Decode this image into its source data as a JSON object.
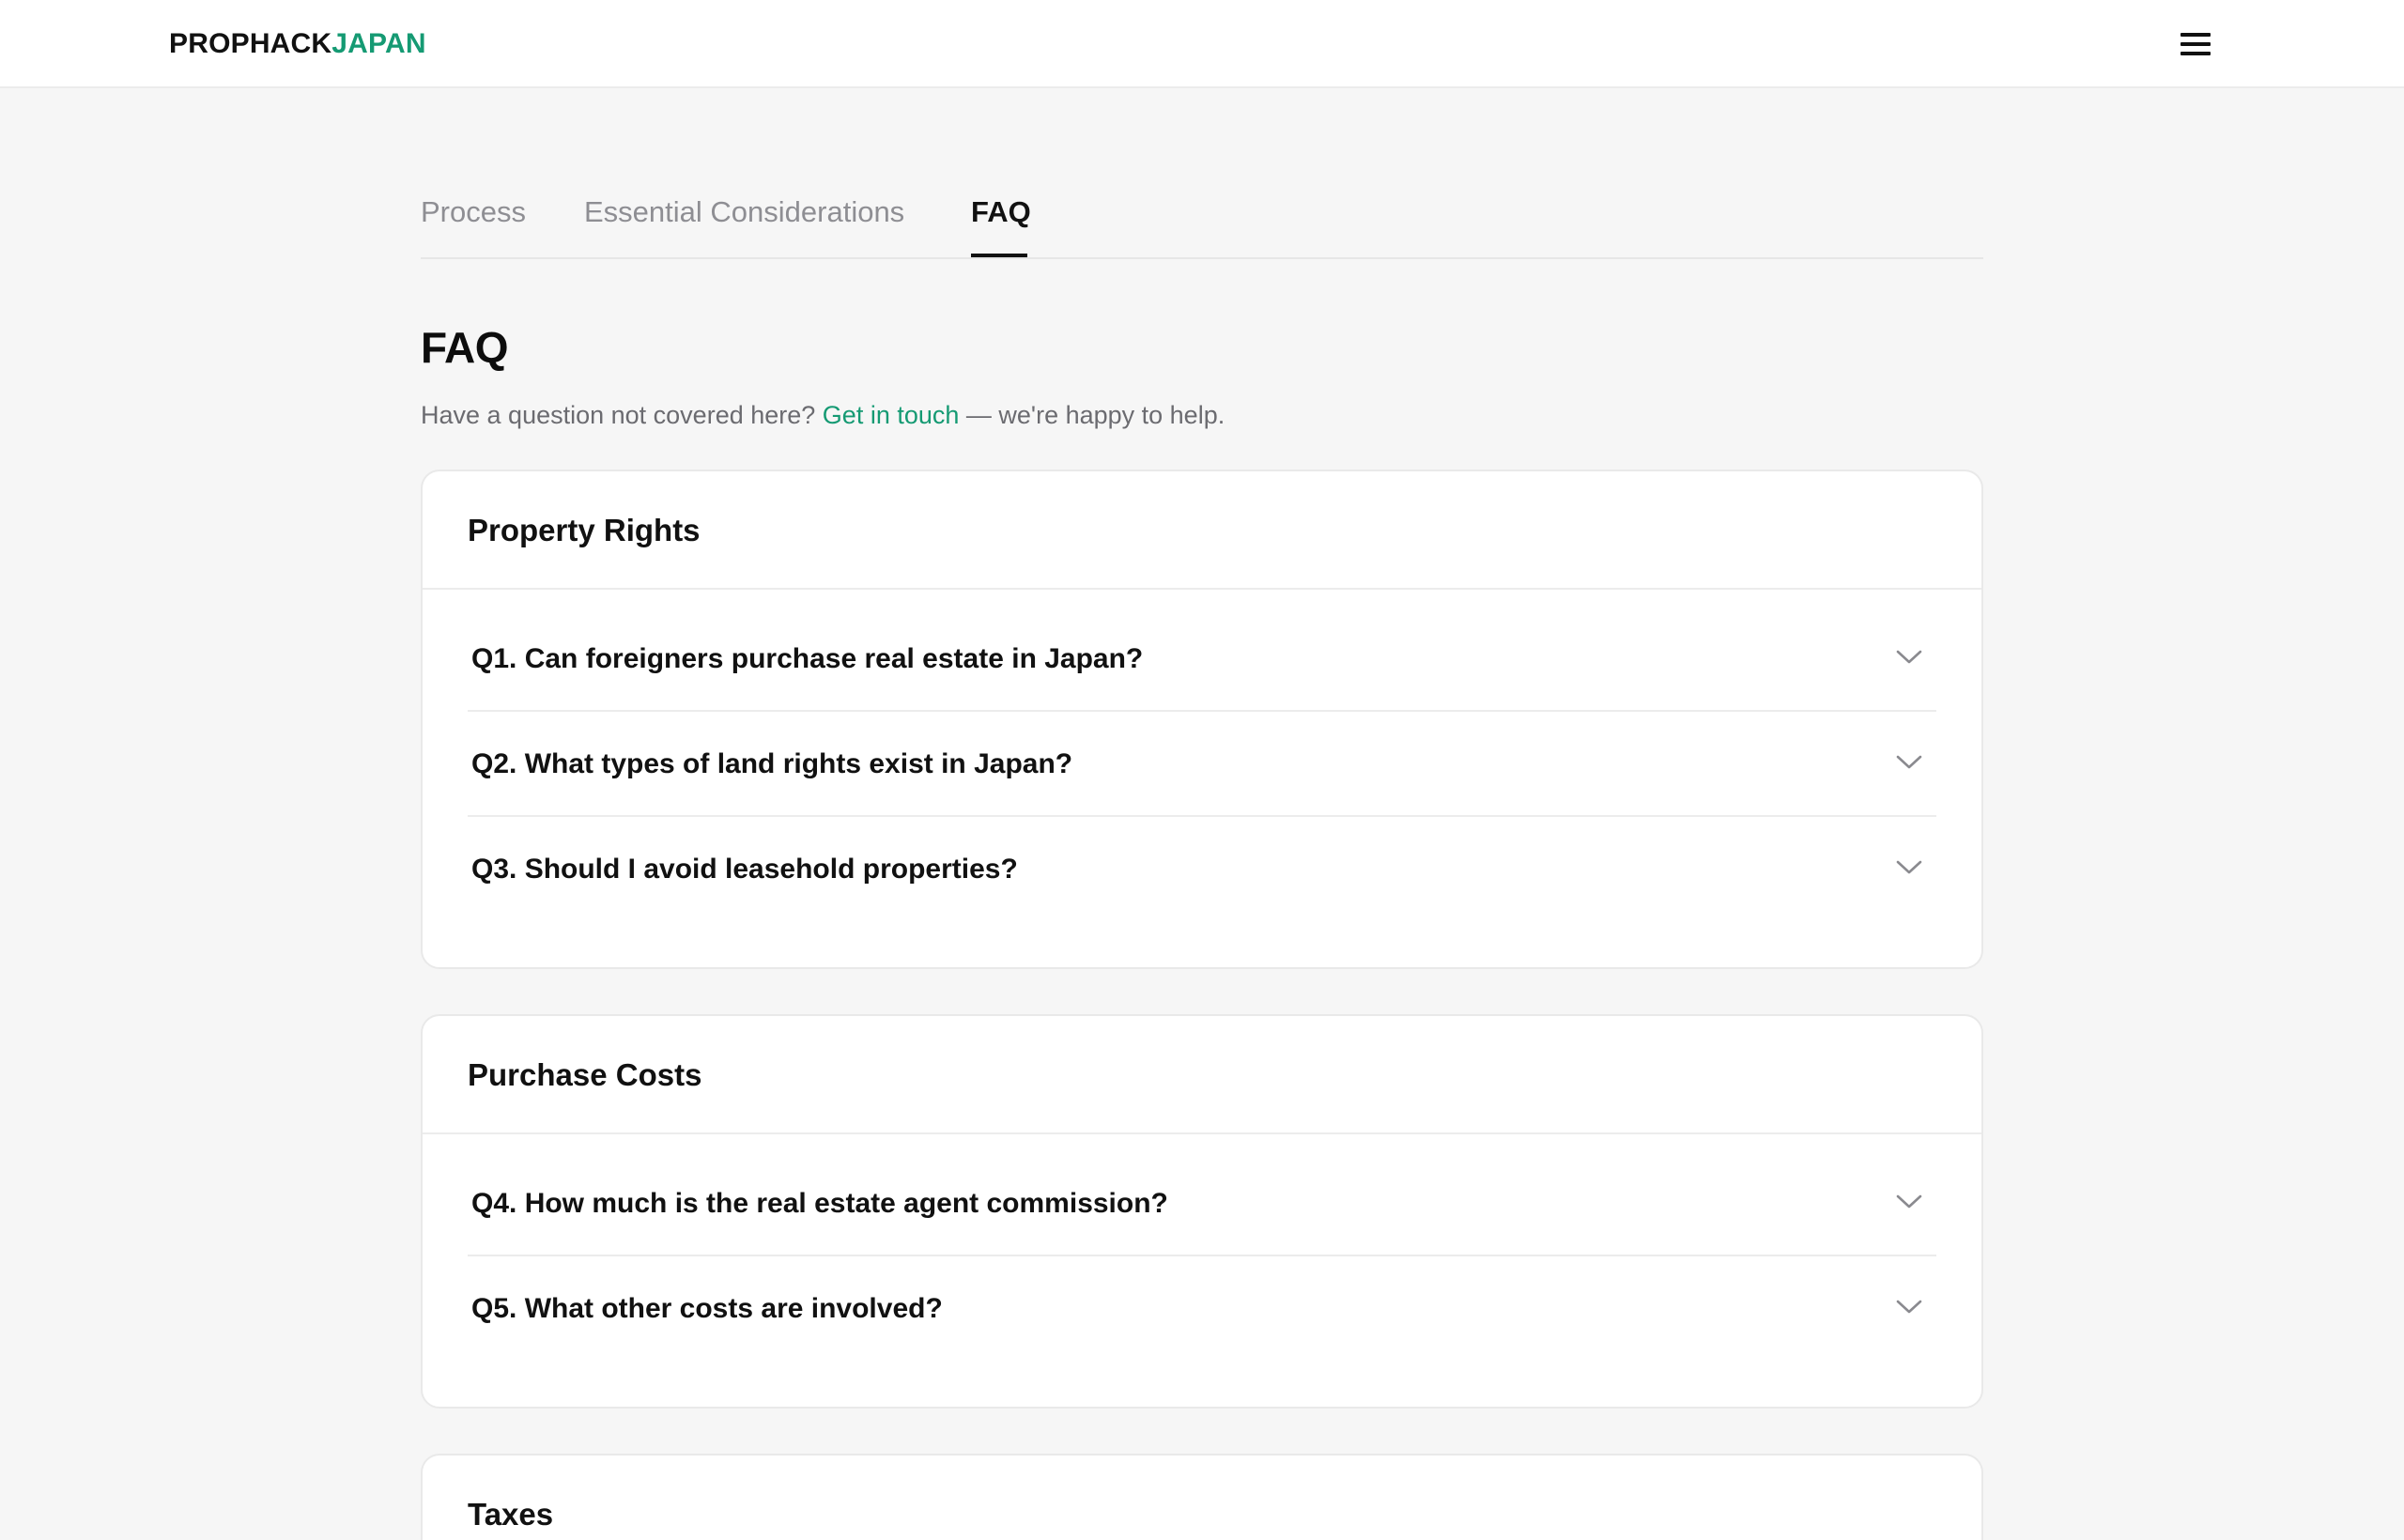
{
  "header": {
    "logo_part1": "PROPHACK",
    "logo_part2": "JAPAN",
    "menu_icon": "hamburger-menu-icon"
  },
  "tabs": [
    {
      "label": "Process",
      "active": false
    },
    {
      "label": "Essential Considerations",
      "active": false
    },
    {
      "label": "FAQ",
      "active": true
    }
  ],
  "page": {
    "title": "FAQ",
    "subtitle_before": "Have a question not covered here?",
    "subtitle_link": "Get in touch",
    "subtitle_after": "— we're happy to help."
  },
  "sections": [
    {
      "title": "Property Rights",
      "questions": [
        "Q1. Can foreigners purchase real estate in Japan?",
        "Q2. What types of land rights exist in Japan?",
        "Q3. Should I avoid leasehold properties?"
      ]
    },
    {
      "title": "Purchase Costs",
      "questions": [
        "Q4. How much is the real estate agent commission?",
        "Q5. What other costs are involved?"
      ]
    },
    {
      "title": "Taxes",
      "questions": []
    }
  ],
  "colors": {
    "accent": "#159a73",
    "background": "#f6f6f6",
    "text": "#111111",
    "muted": "#8e8e93"
  }
}
